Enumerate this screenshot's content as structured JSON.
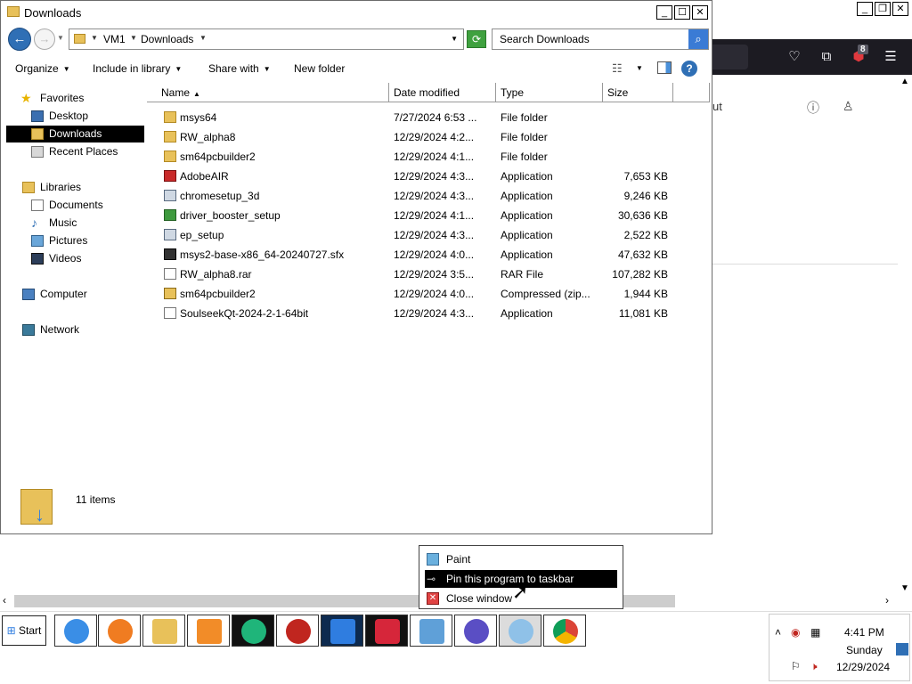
{
  "explorer": {
    "title": "Downloads",
    "breadcrumb": [
      "VM1",
      "Downloads"
    ],
    "search_placeholder": "Search Downloads",
    "commands": {
      "organize": "Organize",
      "include": "Include in library",
      "share": "Share with",
      "new_folder": "New folder"
    },
    "nav": {
      "favorites": "Favorites",
      "desktop": "Desktop",
      "downloads": "Downloads",
      "recent": "Recent Places",
      "libraries": "Libraries",
      "documents": "Documents",
      "music": "Music",
      "pictures": "Pictures",
      "videos": "Videos",
      "computer": "Computer",
      "network": "Network"
    },
    "columns": {
      "name": "Name",
      "date": "Date modified",
      "type": "Type",
      "size": "Size"
    },
    "files": [
      {
        "name": "msys64",
        "date": "7/27/2024 6:53 ...",
        "type": "File folder",
        "size": "",
        "icon": "folder-icon"
      },
      {
        "name": "RW_alpha8",
        "date": "12/29/2024 4:2...",
        "type": "File folder",
        "size": "",
        "icon": "folder-icon"
      },
      {
        "name": "sm64pcbuilder2",
        "date": "12/29/2024 4:1...",
        "type": "File folder",
        "size": "",
        "icon": "folder-icon"
      },
      {
        "name": "AdobeAIR",
        "date": "12/29/2024 4:3...",
        "type": "Application",
        "size": "7,653 KB",
        "icon": "adobe-air-icon"
      },
      {
        "name": "chromesetup_3d",
        "date": "12/29/2024 4:3...",
        "type": "Application",
        "size": "9,246 KB",
        "icon": "setup-icon"
      },
      {
        "name": "driver_booster_setup",
        "date": "12/29/2024 4:1...",
        "type": "Application",
        "size": "30,636 KB",
        "icon": "installer-icon"
      },
      {
        "name": "ep_setup",
        "date": "12/29/2024 4:3...",
        "type": "Application",
        "size": "2,522 KB",
        "icon": "application-icon"
      },
      {
        "name": "msys2-base-x86_64-20240727.sfx",
        "date": "12/29/2024 4:0...",
        "type": "Application",
        "size": "47,632 KB",
        "icon": "7zip-icon"
      },
      {
        "name": "RW_alpha8.rar",
        "date": "12/29/2024 3:5...",
        "type": "RAR File",
        "size": "107,282 KB",
        "icon": "file-icon"
      },
      {
        "name": "sm64pcbuilder2",
        "date": "12/29/2024 4:0...",
        "type": "Compressed (zip...",
        "size": "1,944 KB",
        "icon": "zip-folder-icon"
      },
      {
        "name": "SoulseekQt-2024-2-1-64bit",
        "date": "12/29/2024 4:3...",
        "type": "Application",
        "size": "11,081 KB",
        "icon": "download-icon"
      }
    ],
    "item_count": "11 items"
  },
  "browser": {
    "badge": "8",
    "page_text": "ut"
  },
  "jumplist": {
    "items": [
      "Paint",
      "Pin this program to taskbar",
      "Close window"
    ]
  },
  "taskbar": {
    "start": "Start",
    "time": "4:41 PM",
    "day": "Sunday",
    "date": "12/29/2024"
  }
}
